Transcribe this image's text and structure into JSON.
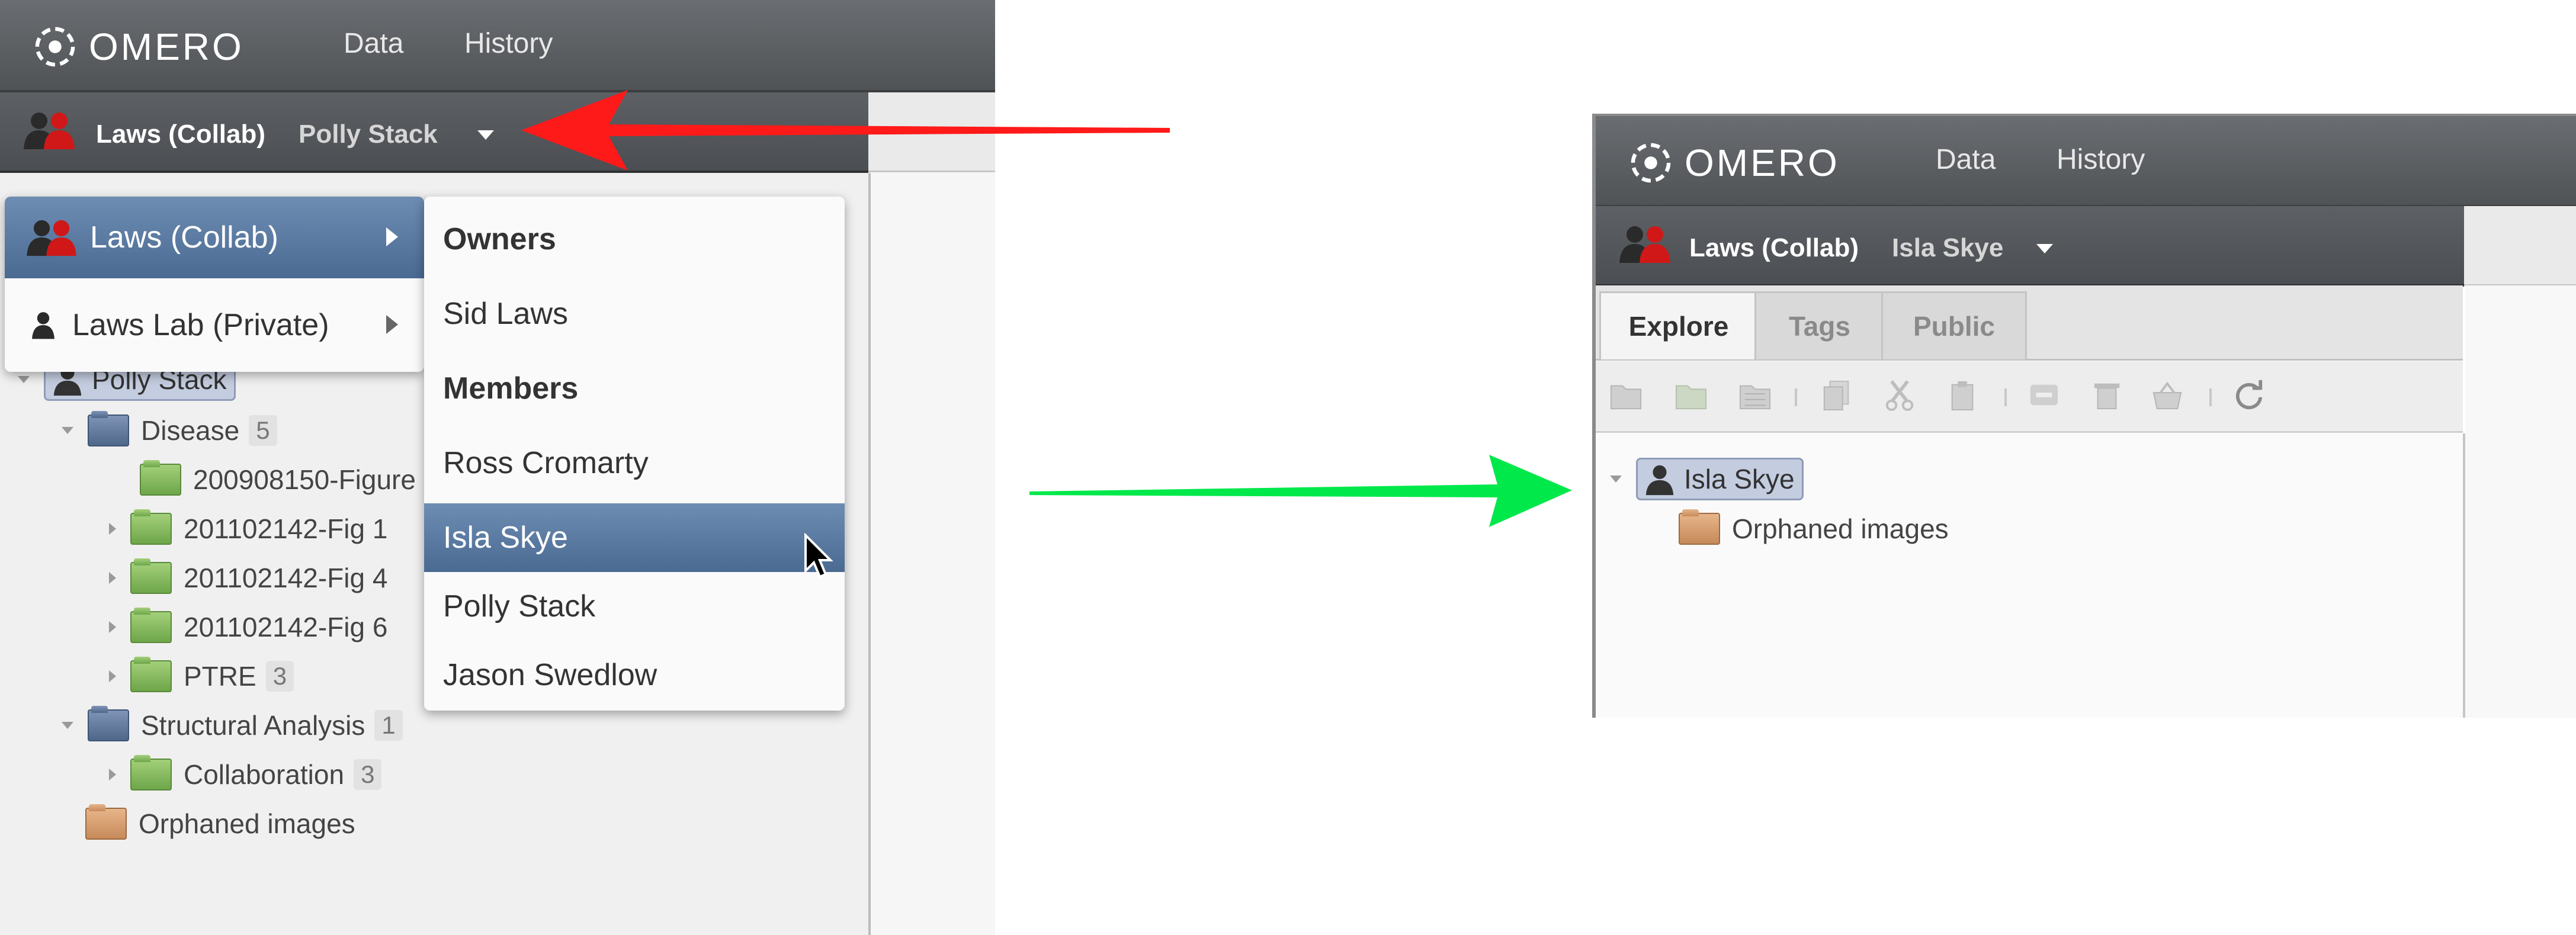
{
  "app": {
    "logo_text": "OMERO",
    "nav": [
      "Data",
      "History"
    ]
  },
  "left": {
    "group_name": "Laws (Collab)",
    "group_user": "Polly Stack",
    "menu_groups": [
      {
        "label": "Laws (Collab)"
      },
      {
        "label": "Laws Lab (Private)"
      }
    ],
    "submenu": {
      "owners_heading": "Owners",
      "owners": [
        "Sid Laws"
      ],
      "members_heading": "Members",
      "members": [
        "Ross Cromarty",
        "Isla Skye",
        "Polly Stack",
        "Jason Swedlow"
      ]
    },
    "tree": {
      "user": "Polly Stack",
      "project1": {
        "name": "Disease",
        "count": "5"
      },
      "datasets1": [
        {
          "name": "200908150-Figure"
        },
        {
          "name": "201102142-Fig 1"
        },
        {
          "name": "201102142-Fig 4"
        },
        {
          "name": "201102142-Fig 6"
        },
        {
          "name": "PTRE",
          "count": "3"
        }
      ],
      "project2": {
        "name": "Structural Analysis",
        "count": "1"
      },
      "datasets2": [
        {
          "name": "Collaboration",
          "count": "3"
        }
      ],
      "orphaned": "Orphaned images"
    }
  },
  "right": {
    "group_name": "Laws (Collab)",
    "group_user": "Isla Skye",
    "tabs": [
      "Explore",
      "Tags",
      "Public"
    ],
    "tree": {
      "user": "Isla Skye",
      "orphaned": "Orphaned images"
    }
  },
  "colors": {
    "red_arrow": "#ff1a1a",
    "green_arrow": "#00e84a",
    "selection": "#5a7aa2"
  }
}
